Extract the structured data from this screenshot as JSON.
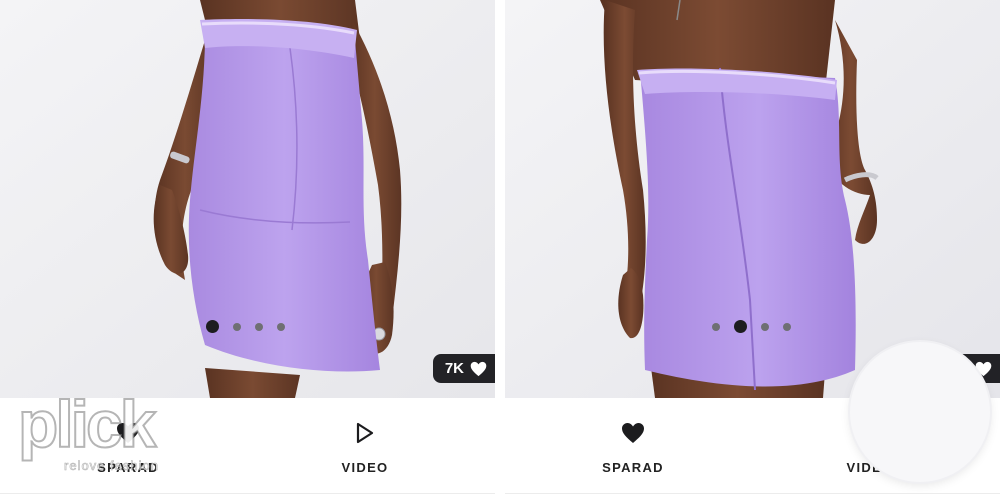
{
  "products": [
    {
      "photo": {
        "view": "front",
        "dress_color": "#b79be8",
        "skin_color": "#6b3f2a"
      },
      "carousel": {
        "total": 4,
        "active_index": 0
      },
      "likes": {
        "count": "7K",
        "icon": "heart-icon"
      },
      "actions": [
        {
          "label": "SPARAD",
          "icon": "heart-icon"
        },
        {
          "label": "VIDEO",
          "icon": "play-icon"
        }
      ]
    },
    {
      "photo": {
        "view": "back",
        "dress_color": "#b79be8",
        "skin_color": "#6b3f2a"
      },
      "carousel": {
        "total": 4,
        "active_index": 1
      },
      "likes": {
        "count": "7K",
        "icon": "heart-icon"
      },
      "actions": [
        {
          "label": "SPARAD",
          "icon": "heart-icon"
        },
        {
          "label": "VIDEO",
          "icon": "play-icon"
        }
      ]
    }
  ],
  "watermark": {
    "brand": "plick",
    "tagline": "relove fashion"
  }
}
